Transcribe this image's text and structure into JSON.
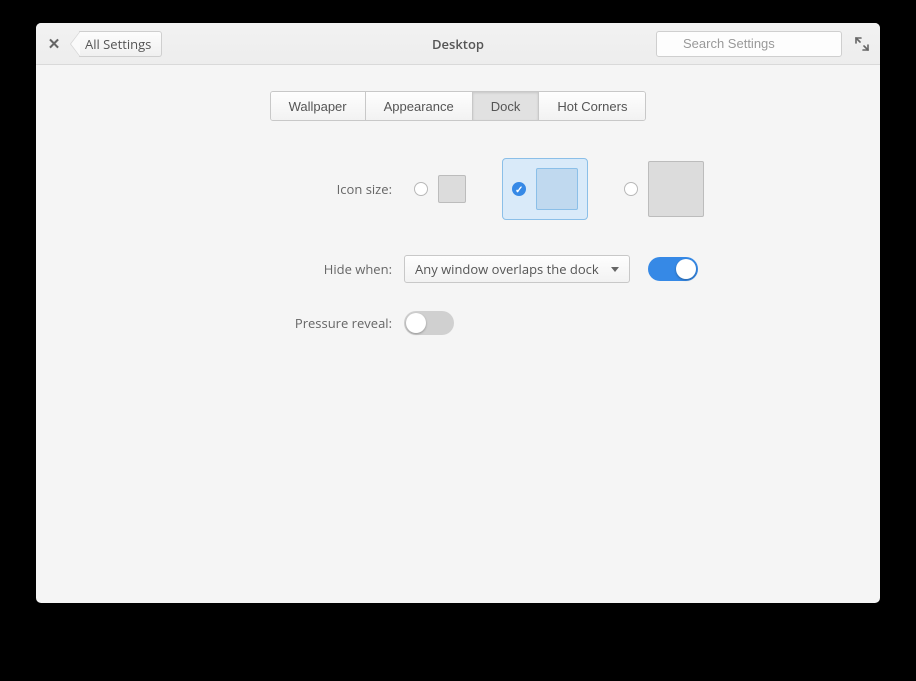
{
  "header": {
    "back_label": "All Settings",
    "title": "Desktop",
    "search_placeholder": "Search Settings"
  },
  "tabs": [
    {
      "label": "Wallpaper",
      "active": false
    },
    {
      "label": "Appearance",
      "active": false
    },
    {
      "label": "Dock",
      "active": true
    },
    {
      "label": "Hot Corners",
      "active": false
    }
  ],
  "labels": {
    "icon_size": "Icon size:",
    "hide_when": "Hide when:",
    "pressure_reveal": "Pressure reveal:"
  },
  "icon_size": {
    "selected_index": 1
  },
  "hide_when": {
    "selected": "Any window overlaps the dock",
    "enabled": true
  },
  "pressure_reveal": {
    "enabled": false
  }
}
